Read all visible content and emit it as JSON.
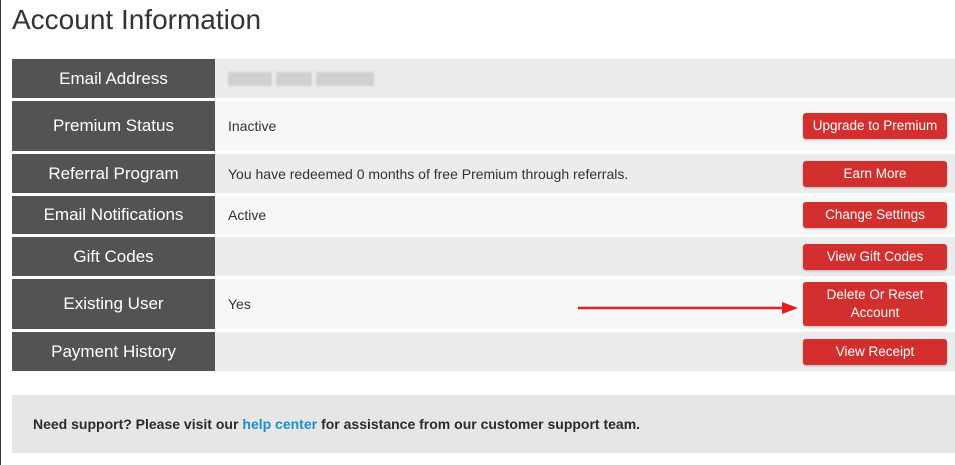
{
  "page": {
    "title": "Account Information"
  },
  "rows": [
    {
      "label": "Email Address",
      "value": "",
      "button": ""
    },
    {
      "label": "Premium Status",
      "value": "Inactive",
      "button": "Upgrade to Premium"
    },
    {
      "label": "Referral Program",
      "value": "You have redeemed 0 months of free Premium through referrals.",
      "button": "Earn More"
    },
    {
      "label": "Email Notifications",
      "value": "Active",
      "button": "Change Settings"
    },
    {
      "label": "Gift Codes",
      "value": "",
      "button": "View Gift Codes"
    },
    {
      "label": "Existing User",
      "value": "Yes",
      "button": "Delete Or Reset Account"
    },
    {
      "label": "Payment History",
      "value": "",
      "button": "View Receipt"
    }
  ],
  "support": {
    "prefix": "Need support? Please visit our",
    "link": "help center",
    "suffix": "for assistance from our customer support team."
  },
  "colors": {
    "label_bg": "#535353",
    "button_bg": "#d32f2f",
    "link": "#1a8fd0",
    "arrow": "#e02020"
  }
}
